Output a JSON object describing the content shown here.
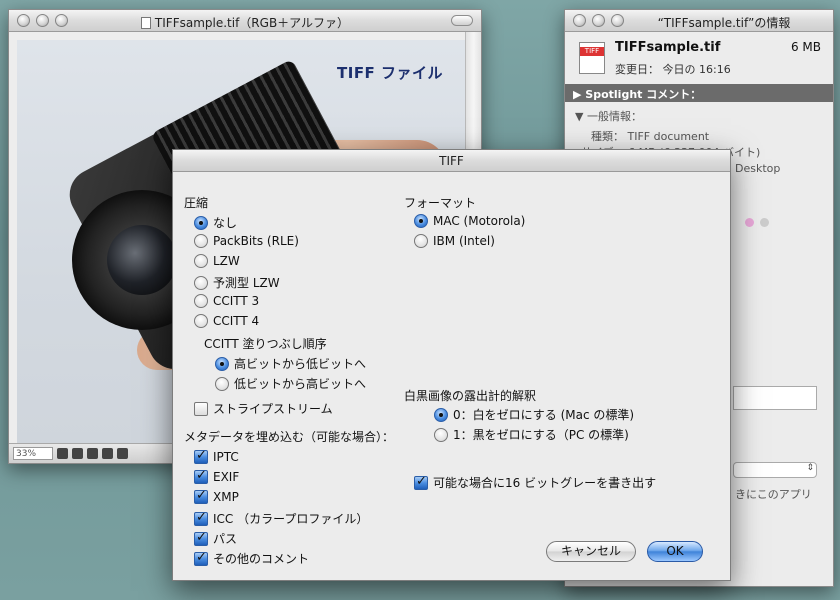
{
  "image_window": {
    "title": "TIFFsample.tif（RGB＋アルファ）",
    "zoom": "33%",
    "photo_caption": "TIFF ファイル"
  },
  "info_window": {
    "title": "“TIFFsample.tif”の情報",
    "file_icon_tag": "TIFF",
    "file_name": "TIFFsample.tif",
    "file_size": "6 MB",
    "modified_label": "変更日：",
    "modified_value": "今日の 16:16",
    "spotlight": "Spotlight コメント：",
    "general_section": "一般情報：",
    "kind_label": "種類：",
    "kind_value": "TIFF document",
    "size_row": "サイズ：   6 MB (6,337,004 バイト)",
    "where_row": "Desktop",
    "open_with_partial": "きにこのアプリ"
  },
  "dialog": {
    "title": "TIFF",
    "compression": {
      "label": "圧縮",
      "options": [
        "なし",
        "PackBits (RLE)",
        "LZW",
        "予測型 LZW",
        "CCITT 3",
        "CCITT 4"
      ],
      "selected": 0
    },
    "fill_order": {
      "label": "CCITT 塗りつぶし順序",
      "options": [
        "高ビットから低ビットへ",
        "低ビットから高ビットへ"
      ],
      "selected": 0
    },
    "stripe_stream": {
      "label": "ストライプストリーム",
      "checked": false
    },
    "metadata": {
      "label": "メタデータを埋め込む（可能な場合）：",
      "items": [
        {
          "label": "IPTC",
          "checked": true
        },
        {
          "label": "EXIF",
          "checked": true
        },
        {
          "label": "XMP",
          "checked": true
        },
        {
          "label": "ICC （カラープロファイル）",
          "checked": true
        },
        {
          "label": "パス",
          "checked": true
        },
        {
          "label": "その他のコメント",
          "checked": true
        }
      ]
    },
    "format": {
      "label": "フォーマット",
      "options": [
        "MAC (Motorola)",
        "IBM (Intel)"
      ],
      "selected": 0
    },
    "photometric": {
      "label": "白黒画像の露出計的解釈",
      "options": [
        "0：白をゼロにする (Mac の標準)",
        "1：黒をゼロにする（PC の標準)"
      ],
      "selected": 0
    },
    "write_16bit": {
      "label": "可能な場合に16 ビットグレーを書き出す",
      "checked": true
    },
    "cancel_label": "キャンセル",
    "ok_label": "OK"
  },
  "colors": {
    "desktop": "#7fa6a6",
    "accent_blue": "#3f83d9",
    "spotlight_bar": "#6b6b6b"
  }
}
